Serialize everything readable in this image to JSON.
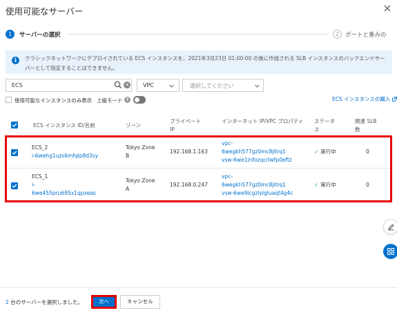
{
  "dialog": {
    "title": "使用可能なサーバー",
    "close_icon": "close-icon"
  },
  "steps": [
    {
      "num": "1",
      "label": "サーバーの選択"
    },
    {
      "num": "2",
      "label": "ポートと重みの"
    }
  ],
  "info": {
    "icon": "info-icon",
    "text": "クラシックネットワークにデプロイされている ECS インスタンスを、2021年3月23日 01:00:00 の後に作成される SLB インスタンスのバックエンドサーバーとして指定することはできません。"
  },
  "filters": {
    "search_value": "ECS",
    "network_value": "VPC",
    "vpc_placeholder": "選択してください",
    "available_only_label": "使用可能なインスタンスのみ表示",
    "advanced_mode_label": "上級モード",
    "advanced_mode_on": false,
    "buy_link": "ECS インスタンスの購入"
  },
  "table": {
    "headers": {
      "instance": "ECS インスタンス ID/名前",
      "zone": "ゾーン",
      "private_ip": "プライベート IP",
      "public_ip": "インターネット IP/VPC プロパティ",
      "status": "ステータス",
      "slb": "関連 SLB 数"
    },
    "rows": [
      {
        "checked": true,
        "name": "ECS_2",
        "id": "i-6wehg1uzs6mfqlp8d3sy",
        "zone_line1": "Tokyo Zone",
        "zone_line2": "B",
        "private_ip": "192.168.1.163",
        "vpc_l1": "vpc-",
        "vpc_l2": "6wegkh577gz0mc8jitrq1",
        "vsw": "vsw-6we1infozqcrlwfp0eftz",
        "status": "実行中",
        "slb_count": "0"
      },
      {
        "checked": true,
        "name": "ECS_1",
        "id_l1": "i-",
        "id_l2": "6we455pru695x1qpxeas",
        "zone_line1": "Tokyo Zone",
        "zone_line2": "A",
        "private_ip": "192.168.0.247",
        "vpc_l1": "vpc-",
        "vpc_l2": "6wegkh577gz0mc8jitrq1",
        "vsw": "vsw-6we9icgzlylgluaqt4g4c",
        "status": "実行中",
        "slb_count": "0"
      }
    ]
  },
  "side_buttons": [
    "edit-icon",
    "grid-icon"
  ],
  "footer": {
    "selected_count": "2",
    "selected_suffix": " 台のサーバーを選択しました。",
    "next_label": "次へ",
    "cancel_label": "キャンセル"
  },
  "colors": {
    "accent": "#0070cc",
    "highlight": "#e50000",
    "info_bg": "#e8f2fb",
    "success": "#22a04a"
  }
}
